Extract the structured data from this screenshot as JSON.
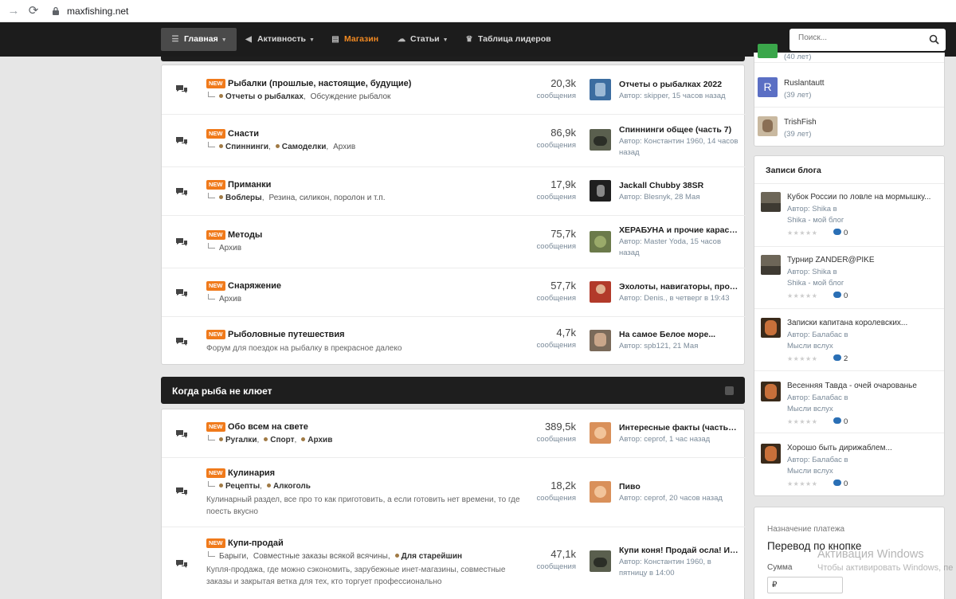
{
  "browser": {
    "url": "maxfishing.net"
  },
  "nav": {
    "items": [
      {
        "label": "Главная",
        "icon": "menu-icon",
        "caret": true
      },
      {
        "label": "Активность",
        "icon": "megaphone-icon",
        "caret": true
      },
      {
        "label": "Магазин",
        "icon": "file-icon",
        "caret": false
      },
      {
        "label": "Статьи",
        "icon": "cloud-icon",
        "caret": true
      },
      {
        "label": "Таблица лидеров",
        "icon": "trophy-icon",
        "caret": false
      }
    ],
    "search_placeholder": "Поиск..."
  },
  "badge_label": "NEW",
  "stat_label": "сообщения",
  "forums1": [
    {
      "title": "Рыбалки (прошлые, настоящие, будущие)",
      "subs": [
        {
          "name": "Отчеты о рыбалках",
          "bold": true
        },
        {
          "name": "Обсуждение рыбалок",
          "bold": false
        }
      ],
      "count": "20,3k",
      "last_title": "Отчеты о рыбалках 2022",
      "last_meta": "Автор: skipper, 15 часов назад"
    },
    {
      "title": "Снасти",
      "subs": [
        {
          "name": "Спиннинги",
          "bold": true
        },
        {
          "name": "Самоделки",
          "bold": true
        },
        {
          "name": "Архив",
          "bold": false
        }
      ],
      "count": "86,9k",
      "last_title": "Спиннинги общее (часть 7)",
      "last_meta": "Автор: Константин 1960, 14 часов назад"
    },
    {
      "title": "Приманки",
      "subs": [
        {
          "name": "Воблеры",
          "bold": true
        },
        {
          "name": "Резина, силикон, поролон и т.п.",
          "bold": false
        }
      ],
      "count": "17,9k",
      "last_title": "Jackall Chubby 38SR",
      "last_meta": "Автор: Blesnyk, 28 Мая"
    },
    {
      "title": "Методы",
      "subs": [
        {
          "name": "Архив",
          "bold": false
        }
      ],
      "count": "75,7k",
      "last_title": "ХЕРАБУНА и прочие карасёвые...",
      "last_meta": "Автор: Master Yoda, 15 часов назад"
    },
    {
      "title": "Снаряжение",
      "subs": [
        {
          "name": "Архив",
          "bold": false
        }
      ],
      "count": "57,7k",
      "last_title": "Эхолоты, навигаторы, прочая...",
      "last_meta": "Автор: Denis., в четверг в 19:43"
    },
    {
      "title": "Рыболовные путешествия",
      "desc": "Форум для поездок на рыбалку в прекрасное далеко",
      "count": "4,7k",
      "last_title": "На самое Белое море...",
      "last_meta": "Автор: spb121, 21 Мая"
    }
  ],
  "category2": {
    "title": "Когда рыба не клюет"
  },
  "forums2": [
    {
      "title": "Обо всем на свете",
      "subs": [
        {
          "name": "Ругалки",
          "bold": true
        },
        {
          "name": "Спорт",
          "bold": true
        },
        {
          "name": "Архив",
          "bold": true
        }
      ],
      "count": "389,5k",
      "last_title": "Интересные факты (часть два)",
      "last_meta": "Автор: cepгоf, 1 час назад"
    },
    {
      "title": "Кулинария",
      "subs": [
        {
          "name": "Рецепты",
          "bold": true
        },
        {
          "name": "Алкоголь",
          "bold": true
        }
      ],
      "desc": "Кулинарный раздел, все про то как приготовить, а если готовить нет времени, то где поесть вкусно",
      "count": "18,2k",
      "last_title": "Пиво",
      "last_meta": "Автор: cepгоf, 20 часов назад"
    },
    {
      "title": "Купи-продай",
      "subs": [
        {
          "name": "Барыги",
          "bold": false
        },
        {
          "name": "Совместные заказы всякой всячины",
          "bold": false
        },
        {
          "name": "Для старейшин",
          "bold": true
        }
      ],
      "desc": "Купля-продажа, где можно сэкономить, зарубежные инет-магазины, совместные заказы и закрытая ветка для тех, кто торгует профессионально",
      "count": "47,1k",
      "last_title": "Купи коня! Продай осла! Или...",
      "last_meta": "Автор: Константин 1960, в пятницу в 14:00"
    }
  ],
  "members": [
    {
      "name": "",
      "age": "(40 лет)",
      "color": "#3aa64a",
      "letter": ""
    },
    {
      "name": "Ruslantautt",
      "age": "(39 лет)",
      "color": "#5b6fc4",
      "letter": "R"
    },
    {
      "name": "TrishFish",
      "age": "(39 лет)",
      "color": "#c9b9a0",
      "letter": ""
    }
  ],
  "blog": {
    "title": "Записи блога",
    "entries": [
      {
        "title": "Кубок России по ловле на мормышку...",
        "author": "Автор: Shika в",
        "blog": "Shika - мой блог",
        "comments": "0"
      },
      {
        "title": "Турнир ZANDER@PIKE",
        "author": "Автор: Shika в",
        "blog": "Shika - мой блог",
        "comments": "0"
      },
      {
        "title": "Записки капитана королевских...",
        "author": "Автор: Балабас в",
        "blog": "Мысли вслух",
        "comments": "2"
      },
      {
        "title": "Весенняя Тавда - очей очарованье",
        "author": "Автор: Балабас в",
        "blog": "Мысли вслух",
        "comments": "0"
      },
      {
        "title": "Хорошо быть дирижаблем...",
        "author": "Автор: Балабас в",
        "blog": "Мысли вслух",
        "comments": "0"
      }
    ]
  },
  "payment": {
    "label": "Назначение платежа",
    "title": "Перевод по кнопке",
    "sum_label": "Сумма",
    "currency": "₽"
  },
  "watermark": {
    "line1": "Активация Windows",
    "line2": "Чтобы активировать Windows, пе"
  }
}
